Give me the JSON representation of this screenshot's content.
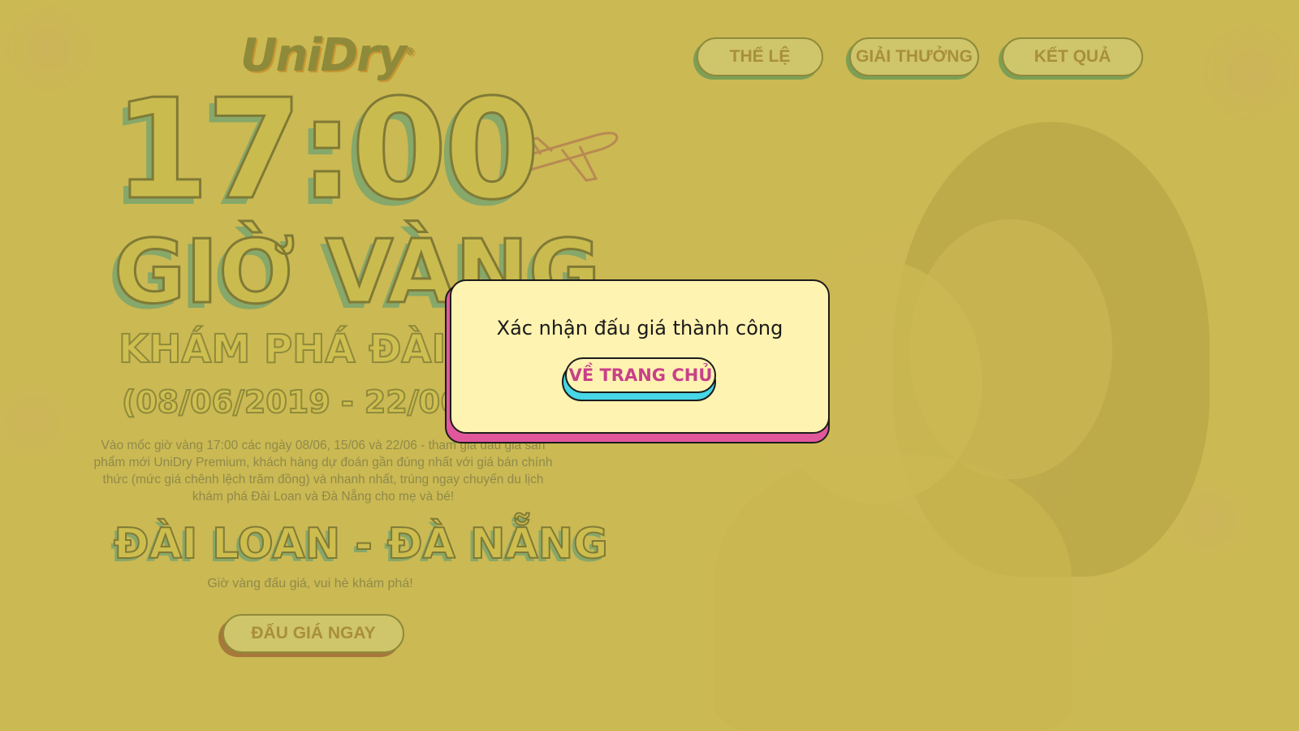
{
  "brand": {
    "logo_text": "UniDry",
    "registered_mark": "®"
  },
  "nav": {
    "items": [
      {
        "label": "THỂ LỆ"
      },
      {
        "label": "GIẢI THƯỞNG"
      },
      {
        "label": "KẾT QUẢ"
      }
    ]
  },
  "hero": {
    "time": "17:00",
    "headline": "GIỜ VÀNG",
    "subheadline": "KHÁM PHÁ ĐÀI LOAN",
    "date_range": "(08/06/2019 - 22/06/2019)",
    "description": "Vào mốc giờ vàng 17:00 các ngày 08/06, 15/06 và 22/06 - tham gia đấu giá sản phẩm mới UniDry Premium, khách hàng dự đoán gần đúng nhất với giá bán chính thức (mức giá chênh lệch trăm đồng) và nhanh nhất, trúng ngay chuyến du lịch khám phá Đài Loan và Đà Nẵng cho mẹ và bé!",
    "destination": "ĐÀI LOAN - ĐÀ NẴNG",
    "tagline": "Giờ vàng đấu giá, vui hè khám phá!",
    "cta_label": "ĐẤU GIÁ NGAY"
  },
  "modal": {
    "message": "Xác nhận đấu giá thành công",
    "button_label": "VỀ TRANG CHỦ"
  },
  "colors": {
    "overlay": "#c4b44a",
    "modal_bg": "#fff3b1",
    "modal_shadow": "#e0589b",
    "button_text": "#c8408a",
    "button_shadow": "#47d7e6"
  },
  "icons": {
    "plane": "airplane-icon"
  }
}
